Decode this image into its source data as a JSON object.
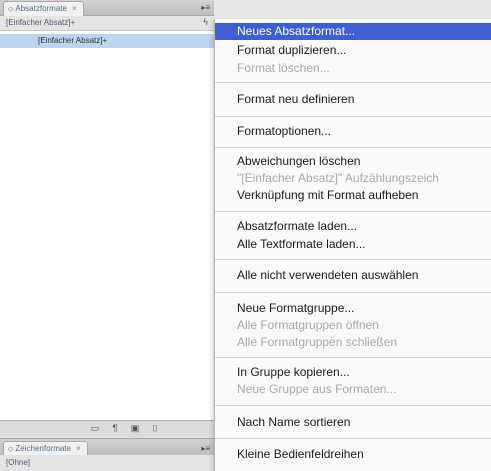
{
  "panel": {
    "tab_label": "Absatzformate",
    "tab_close": "×",
    "current_style": "[Einfacher Absatz]+",
    "list_items": [
      "[Einfacher Absatz]+"
    ],
    "menu_icon": "menu-icon"
  },
  "panel2": {
    "tab_label": "Zeichenformate",
    "tab_close": "×",
    "current_style": "[Ohne]"
  },
  "menu": {
    "items": [
      {
        "label": "Neues Absatzformat...",
        "state": "selected"
      },
      {
        "label": "Format duplizieren...",
        "state": "enabled"
      },
      {
        "label": "Format löschen...",
        "state": "disabled"
      },
      {
        "label": "Format neu definieren",
        "state": "enabled"
      },
      {
        "label": "Formatoptionen...",
        "state": "enabled"
      },
      {
        "label": "Abweichungen löschen",
        "state": "enabled"
      },
      {
        "label": "\"[Einfacher Absatz]\" Aufzählungszeich",
        "state": "disabled"
      },
      {
        "label": "Verknüpfung mit Format aufheben",
        "state": "enabled"
      },
      {
        "label": "Absatzformate laden...",
        "state": "enabled"
      },
      {
        "label": "Alle Textformate laden...",
        "state": "enabled"
      },
      {
        "label": "Alle nicht verwendeten auswählen",
        "state": "enabled"
      },
      {
        "label": "Neue Formatgruppe...",
        "state": "enabled"
      },
      {
        "label": "Alle Formatgruppen öffnen",
        "state": "disabled"
      },
      {
        "label": "Alle Formatgruppen schließen",
        "state": "disabled"
      },
      {
        "label": "In Gruppe kopieren...",
        "state": "enabled"
      },
      {
        "label": "Neue Gruppe aus Formaten...",
        "state": "disabled"
      },
      {
        "label": "Nach Name sortieren",
        "state": "enabled"
      },
      {
        "label": "Kleine Bedienfeldreihen",
        "state": "enabled"
      }
    ],
    "selection_color": "#3d5fd0",
    "disabled_color": "#a8a8a8"
  }
}
